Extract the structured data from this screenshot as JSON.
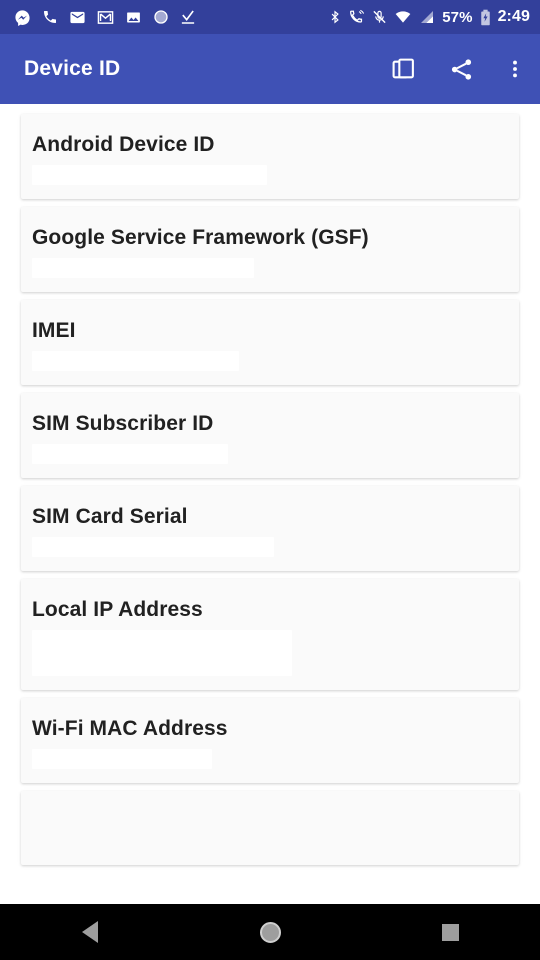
{
  "status_bar": {
    "background_color": "#33409B",
    "left_icons": [
      {
        "name": "messenger-icon"
      },
      {
        "name": "phone-icon"
      },
      {
        "name": "email-icon"
      },
      {
        "name": "gmail-icon"
      },
      {
        "name": "photo-icon"
      },
      {
        "name": "circle-sync-icon"
      },
      {
        "name": "checkmark-underline-icon"
      }
    ],
    "right_icons": [
      {
        "name": "bluetooth-icon"
      },
      {
        "name": "call-vibrate-icon"
      },
      {
        "name": "microphone-muted-icon"
      },
      {
        "name": "wifi-icon"
      },
      {
        "name": "cellular-signal-icon"
      }
    ],
    "battery_percent": "57%",
    "battery_icon": "battery-charging-icon",
    "clock": "2:49"
  },
  "app_bar": {
    "title": "Device ID",
    "background_color": "#3F51B5",
    "actions": [
      {
        "name": "copy-all-button",
        "icon": "copy-icon"
      },
      {
        "name": "share-button",
        "icon": "share-icon"
      },
      {
        "name": "overflow-menu-button",
        "icon": "more-vert-icon"
      }
    ]
  },
  "main": {
    "cards": [
      {
        "title": "Android Device ID",
        "value": "",
        "value_redacted": true,
        "value_width": 235,
        "tall": false
      },
      {
        "title": "Google Service Framework (GSF)",
        "value": "",
        "value_redacted": true,
        "value_width": 222,
        "tall": false
      },
      {
        "title": "IMEI",
        "value": "",
        "value_redacted": true,
        "value_width": 207,
        "tall": false
      },
      {
        "title": "SIM Subscriber ID",
        "value": "",
        "value_redacted": true,
        "value_width": 196,
        "tall": false
      },
      {
        "title": "SIM Card Serial",
        "value": "",
        "value_redacted": true,
        "value_width": 242,
        "tall": false
      },
      {
        "title": "Local IP Address",
        "value": "",
        "value_redacted": true,
        "value_width": 260,
        "tall": true
      },
      {
        "title": "Wi-Fi MAC Address",
        "value": "",
        "value_redacted": true,
        "value_width": 180,
        "tall": false
      },
      {
        "title": "",
        "value": "",
        "value_redacted": false,
        "value_width": 0,
        "tall": false
      }
    ]
  },
  "nav_bar": {
    "background_color": "#000000",
    "buttons": [
      {
        "name": "nav-back-button",
        "icon": "triangle-back-icon"
      },
      {
        "name": "nav-home-button",
        "icon": "circle-home-icon"
      },
      {
        "name": "nav-recents-button",
        "icon": "square-recents-icon"
      }
    ]
  }
}
